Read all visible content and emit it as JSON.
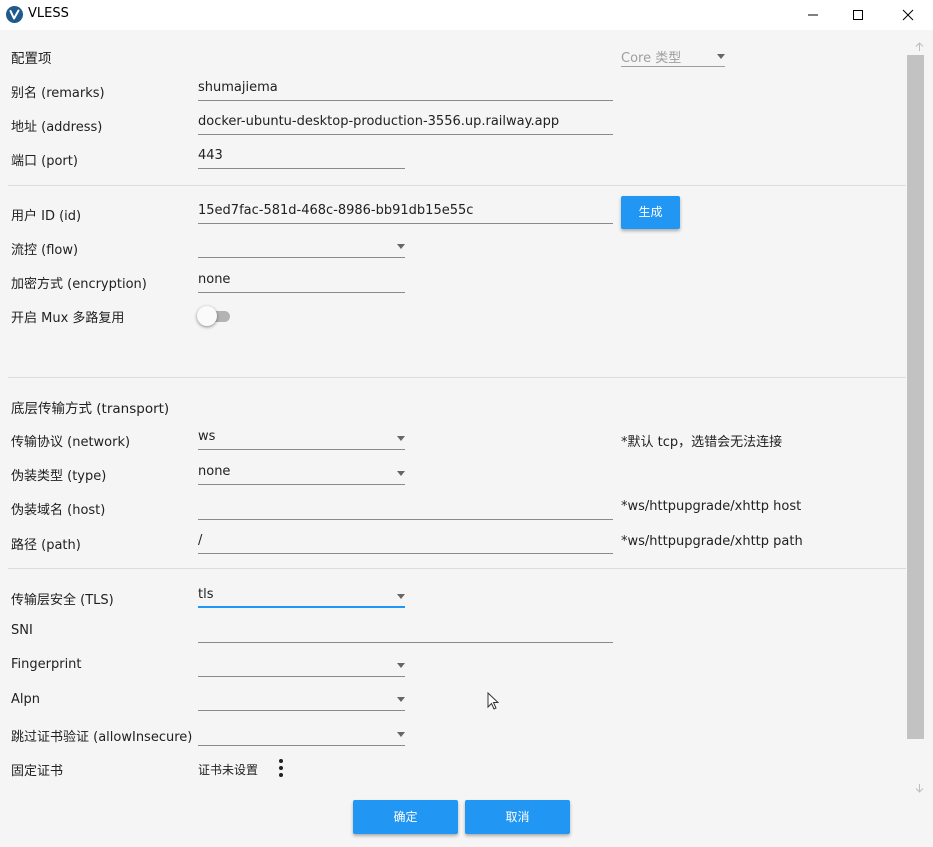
{
  "window": {
    "title": "VLESS"
  },
  "header": {
    "section_label": "配置项",
    "core_type_placeholder": "Core 类型"
  },
  "fields": {
    "remarks": {
      "label": "别名 (remarks)",
      "value": "shumajiema"
    },
    "address": {
      "label": "地址 (address)",
      "value": "docker-ubuntu-desktop-production-3556.up.railway.app"
    },
    "port": {
      "label": "端口 (port)",
      "value": "443"
    },
    "id": {
      "label": "用户 ID (id)",
      "value": "15ed7fac-581d-468c-8986-bb91db15e55c",
      "generate_label": "生成"
    },
    "flow": {
      "label": "流控 (flow)",
      "value": ""
    },
    "encryption": {
      "label": "加密方式 (encryption)",
      "value": "none"
    },
    "mux": {
      "label": "开启 Mux 多路复用",
      "enabled": false
    }
  },
  "transport": {
    "section_label": "底层传输方式 (transport)",
    "network": {
      "label": "传输协议 (network)",
      "value": "ws",
      "hint": "*默认 tcp，选错会无法连接"
    },
    "type": {
      "label": "伪装类型 (type)",
      "value": "none"
    },
    "host": {
      "label": "伪装域名 (host)",
      "value": "",
      "hint": "*ws/httpupgrade/xhttp host"
    },
    "path": {
      "label": "路径 (path)",
      "value": "/",
      "hint": "*ws/httpupgrade/xhttp path"
    }
  },
  "tls": {
    "security": {
      "label": "传输层安全 (TLS)",
      "value": "tls"
    },
    "sni": {
      "label": "SNI",
      "value": ""
    },
    "fingerprint": {
      "label": "Fingerprint",
      "value": ""
    },
    "alpn": {
      "label": "Alpn",
      "value": ""
    },
    "allow_insecure": {
      "label": "跳过证书验证 (allowInsecure)",
      "value": ""
    },
    "pinned_cert": {
      "label": "固定证书",
      "status": "证书未设置"
    }
  },
  "footer": {
    "ok_label": "确定",
    "cancel_label": "取消"
  },
  "colors": {
    "accent": "#2196f3",
    "background": "#f5f5f5",
    "divider": "#dcdcdc"
  }
}
